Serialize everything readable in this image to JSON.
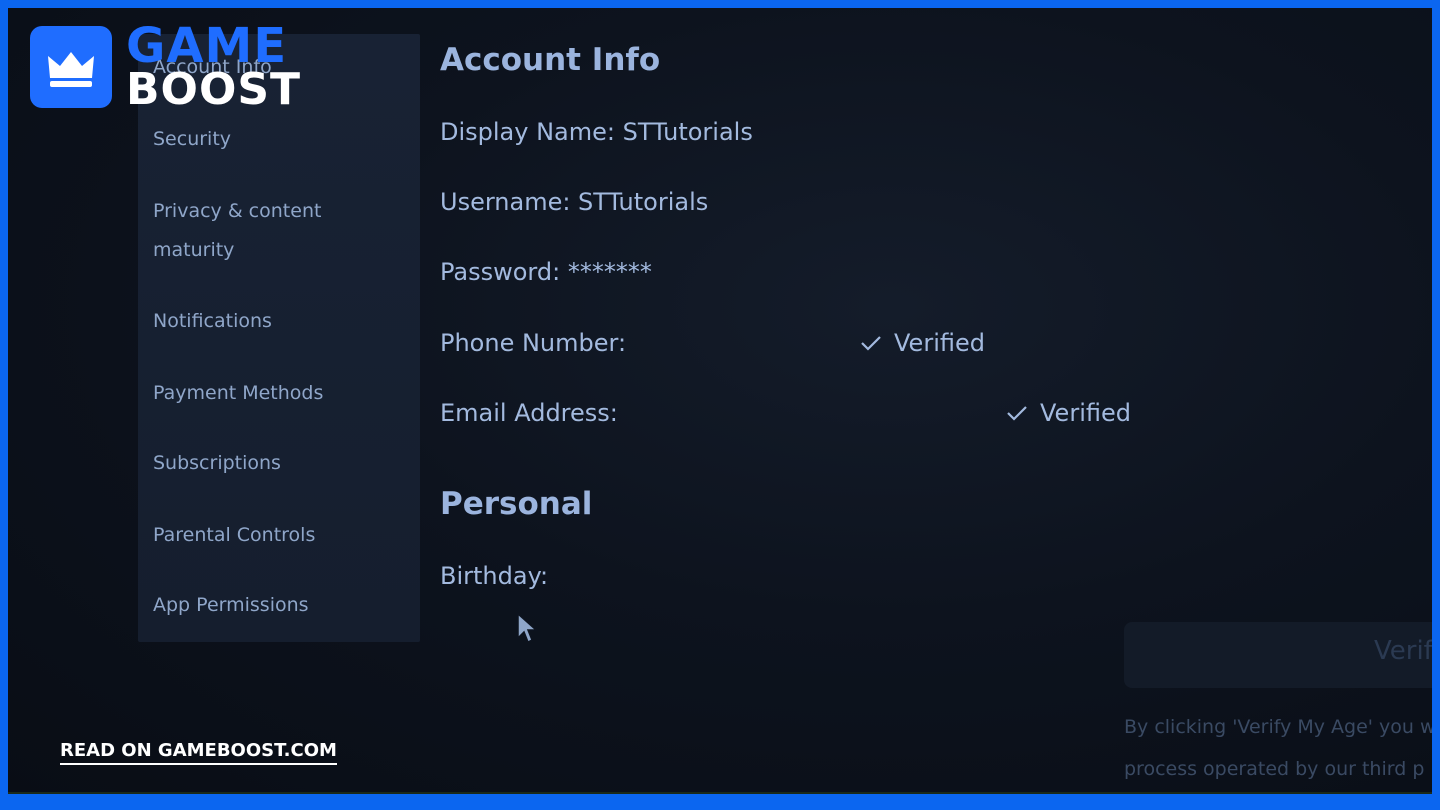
{
  "brand": {
    "word_top": "GAME",
    "word_bottom": "BOOST",
    "icon": "crown-icon",
    "colors": {
      "blue": "#1f6dff",
      "frame": "#0b66f0"
    }
  },
  "sidebar": {
    "items": [
      {
        "label": "Account Info"
      },
      {
        "label": "Security"
      },
      {
        "label": "Privacy & content"
      },
      {
        "label": "maturity"
      },
      {
        "label": "Notifications"
      },
      {
        "label": "Payment Methods"
      },
      {
        "label": "Subscriptions"
      },
      {
        "label": "Parental Controls"
      },
      {
        "label": "App Permissions"
      }
    ]
  },
  "account": {
    "heading": "Account Info",
    "display_name": "Display Name: STTutorials",
    "username": "Username: STTutorials",
    "password": "Password: *******",
    "phone_label": "Phone Number:",
    "phone_status": "Verified",
    "email_label": "Email Address:",
    "email_status": "Verified"
  },
  "personal": {
    "heading": "Personal",
    "birthday_label": "Birthday:"
  },
  "verify": {
    "button_label": "Verify My Age",
    "disclaimer_line1": "By clicking 'Verify My Age' you w",
    "disclaimer_line2": "process operated by our third p"
  },
  "footer": {
    "link": "READ ON GAMEBOOST.COM"
  }
}
